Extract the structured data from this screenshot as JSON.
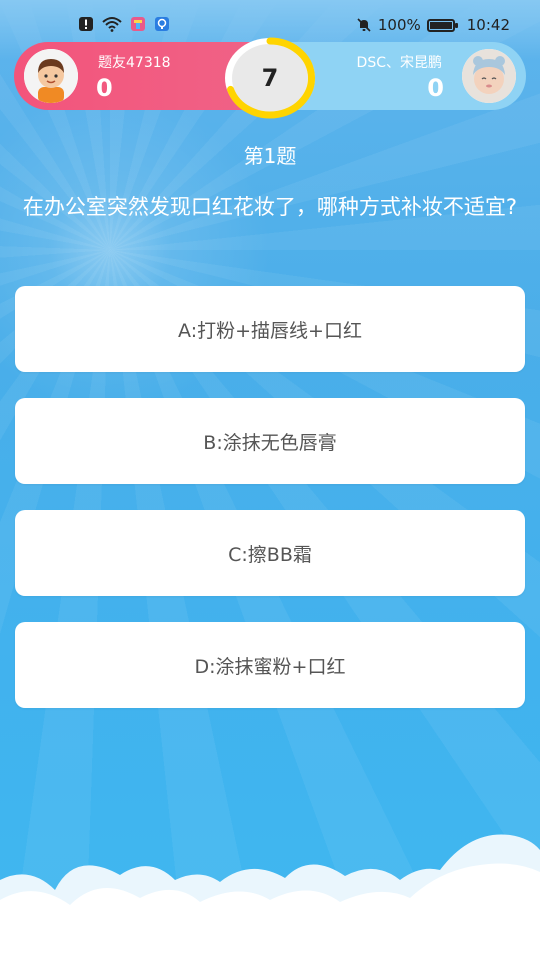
{
  "status_bar": {
    "battery_text": "100%",
    "battery_level": 1.0,
    "time": "10:42",
    "icons": [
      "alert-icon",
      "wifi-icon",
      "app-badge-icon",
      "shield-icon",
      "mute-bell-icon",
      "battery-icon"
    ]
  },
  "players": {
    "left": {
      "name": "题友47318",
      "score": "0",
      "avatar": "boy-avatar",
      "color": "#f3547b"
    },
    "right": {
      "name": "DSC、宋昆鹏",
      "score": "0",
      "avatar": "baby-avatar",
      "color": "#8fd3f4"
    }
  },
  "timer": {
    "value": "7",
    "progress": 0.7,
    "ring_color": "#ffd400"
  },
  "question": {
    "number_label": "第1题",
    "text": "在办公室突然发现口红花妆了，哪种方式补妆不适宜?"
  },
  "options": [
    {
      "label": "A:打粉+描唇线+口红"
    },
    {
      "label": "B:涂抹无色唇膏"
    },
    {
      "label": "C:擦BB霜"
    },
    {
      "label": "D:涂抹蜜粉+口红"
    }
  ]
}
